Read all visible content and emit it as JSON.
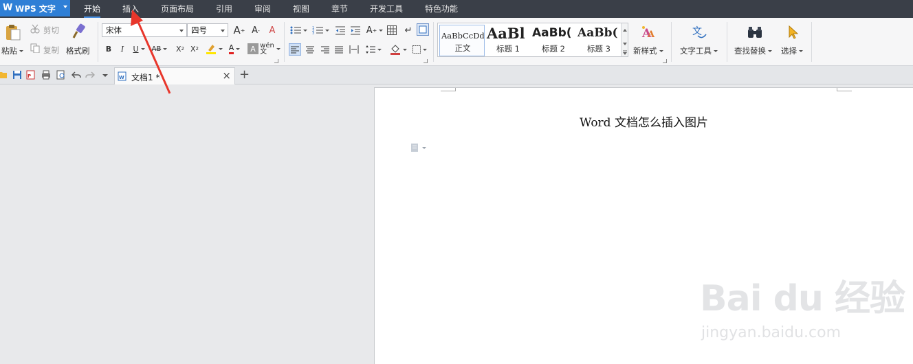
{
  "app": {
    "name": "WPS 文字"
  },
  "menu": [
    {
      "label": "开始",
      "active": true
    },
    {
      "label": "插入",
      "active": false
    },
    {
      "label": "页面布局",
      "active": false
    },
    {
      "label": "引用",
      "active": false
    },
    {
      "label": "审阅",
      "active": false
    },
    {
      "label": "视图",
      "active": false
    },
    {
      "label": "章节",
      "active": false
    },
    {
      "label": "开发工具",
      "active": false
    },
    {
      "label": "特色功能",
      "active": false
    }
  ],
  "clipboard": {
    "paste": "粘贴",
    "cut": "剪切",
    "copy": "复制",
    "format_painter": "格式刷"
  },
  "font": {
    "family": "宋体",
    "size": "四号"
  },
  "styles": {
    "items": [
      {
        "sample": "AaBbCcDd",
        "name": "正文"
      },
      {
        "sample": "AaBl",
        "name": "标题 1"
      },
      {
        "sample": "AaBb(",
        "name": "标题 2"
      },
      {
        "sample": "AaBb(",
        "name": "标题 3"
      }
    ],
    "new_style": "新样式"
  },
  "tools": {
    "text_tools": "文字工具",
    "find_replace": "查找替换",
    "select": "选择"
  },
  "tabs": {
    "doc_tab": "文档1 *"
  },
  "document": {
    "title": "Word 文档怎么插入图片"
  },
  "watermark": {
    "brand": "Bai du 经验",
    "url": "jingyan.baidu.com"
  },
  "colors": {
    "accent": "#2f7fd6",
    "menubar": "#3a3f48",
    "annotation_arrow": "#e8362b"
  },
  "icons": [
    "paste-icon",
    "cut-icon",
    "copy-icon",
    "format-painter-icon",
    "bullets-icon",
    "numbering-icon",
    "table-icon",
    "new-style-icon",
    "text-tools-icon",
    "binoculars-icon",
    "cursor-icon",
    "save-icon",
    "undo-icon",
    "redo-icon"
  ]
}
